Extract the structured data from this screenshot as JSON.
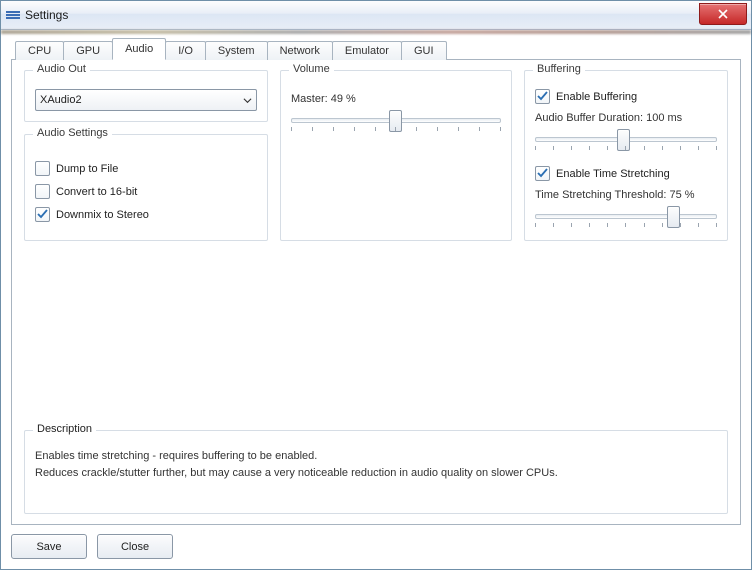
{
  "window": {
    "title": "Settings"
  },
  "tabs": [
    "CPU",
    "GPU",
    "Audio",
    "I/O",
    "System",
    "Network",
    "Emulator",
    "GUI"
  ],
  "active_tab": "Audio",
  "audio_out": {
    "group_label": "Audio Out",
    "selected": "XAudio2"
  },
  "audio_settings": {
    "group_label": "Audio Settings",
    "dump_label": "Dump to File",
    "dump_checked": false,
    "convert_label": "Convert to 16-bit",
    "convert_checked": false,
    "downmix_label": "Downmix to Stereo",
    "downmix_checked": true
  },
  "volume": {
    "group_label": "Volume",
    "master_label": "Master: 49 %",
    "master_value": 49
  },
  "buffering": {
    "group_label": "Buffering",
    "enable_buffering_label": "Enable Buffering",
    "enable_buffering_checked": true,
    "duration_label": "Audio Buffer Duration: 100 ms",
    "duration_value": 100,
    "enable_stretch_label": "Enable Time Stretching",
    "enable_stretch_checked": true,
    "threshold_label": "Time Stretching Threshold: 75 %",
    "threshold_value": 75
  },
  "description": {
    "group_label": "Description",
    "line1": "Enables time stretching - requires buffering to be enabled.",
    "line2": "Reduces crackle/stutter further, but may cause a very noticeable reduction in audio quality on slower CPUs."
  },
  "footer": {
    "save": "Save",
    "close": "Close"
  }
}
